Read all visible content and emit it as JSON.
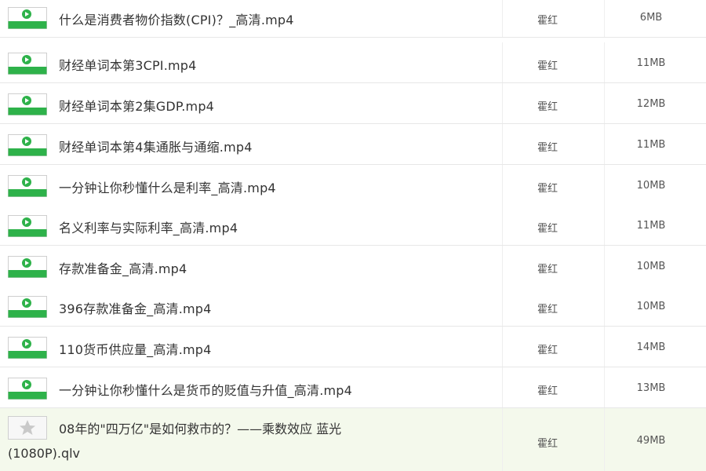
{
  "files": [
    {
      "name": "什么是消费者物价指数(CPI)？_高清.mp4",
      "owner": "霍红",
      "size": "6MB",
      "type": "video"
    },
    {
      "name": "财经单词本第3CPI.mp4",
      "owner": "霍红",
      "size": "11MB",
      "type": "video"
    },
    {
      "name": "财经单词本第2集GDP.mp4",
      "owner": "霍红",
      "size": "12MB",
      "type": "video"
    },
    {
      "name": "财经单词本第4集通胀与通缩.mp4",
      "owner": "霍红",
      "size": "11MB",
      "type": "video"
    },
    {
      "name": "一分钟让你秒懂什么是利率_高清.mp4",
      "owner": "霍红",
      "size": "10MB",
      "type": "video"
    },
    {
      "name": "名义利率与实际利率_高清.mp4",
      "owner": "霍红",
      "size": "11MB",
      "type": "video"
    },
    {
      "name": "存款准备金_高清.mp4",
      "owner": "霍红",
      "size": "10MB",
      "type": "video"
    },
    {
      "name": "396存款准备金_高清.mp4",
      "owner": "霍红",
      "size": "10MB",
      "type": "video"
    },
    {
      "name": "110货币供应量_高清.mp4",
      "owner": "霍红",
      "size": "14MB",
      "type": "video"
    },
    {
      "name": "一分钟让你秒懂什么是货币的贬值与升值_高清.mp4",
      "owner": "霍红",
      "size": "13MB",
      "type": "video"
    }
  ],
  "last_file": {
    "name_line1": "08年的\"四万亿\"是如何救市的？——乘数效应 蓝光",
    "name_line2": "(1080P).qlv",
    "owner": "霍红",
    "size": "49MB",
    "type": "unknown"
  },
  "colors": {
    "video_icon_green": "#2eb24a",
    "row_highlight": "#f4f9ec",
    "text": "#333333",
    "meta_text": "#555555"
  },
  "icons": {
    "video": "video-file-icon",
    "unknown": "star-file-icon"
  }
}
